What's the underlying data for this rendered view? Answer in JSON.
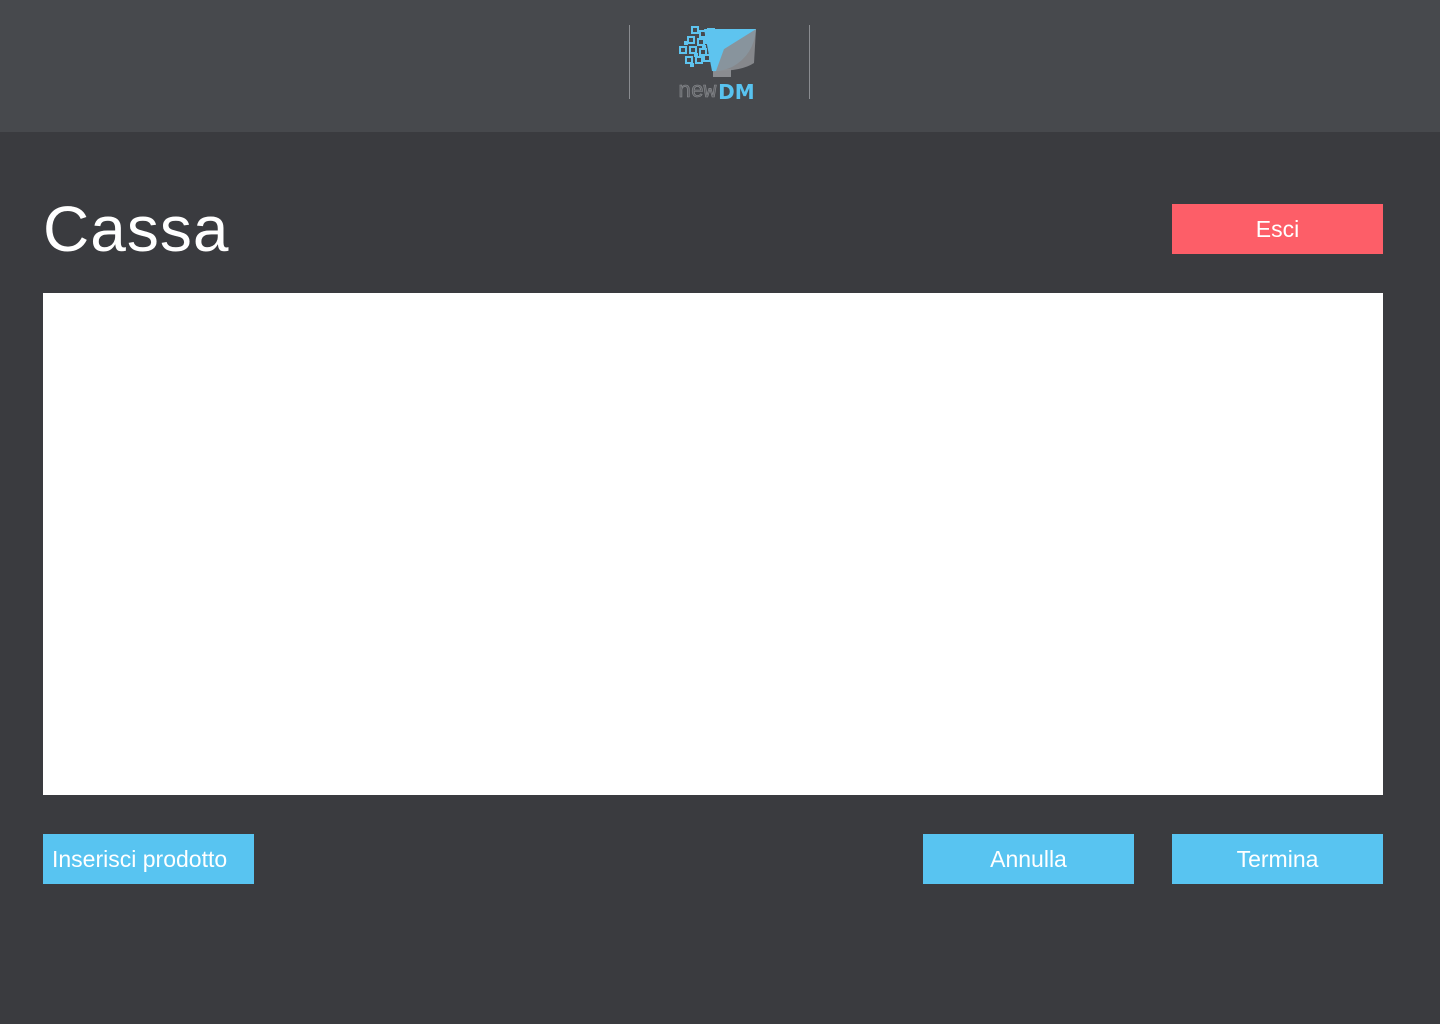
{
  "header": {
    "logo": {
      "text_new": "new",
      "text_dm": "DM",
      "icon": "monitor-pixels-icon",
      "accent_color": "#58c3f0"
    }
  },
  "page": {
    "title": "Cassa",
    "exit_button": "Esci"
  },
  "products_panel": {
    "items": []
  },
  "actions": {
    "insert_product": "Inserisci prodotto",
    "cancel": "Annulla",
    "finish": "Termina"
  },
  "colors": {
    "background": "#3a3b3f",
    "topbar": "#47494d",
    "primary_button": "#58c4f1",
    "danger_button": "#fd5e68"
  }
}
